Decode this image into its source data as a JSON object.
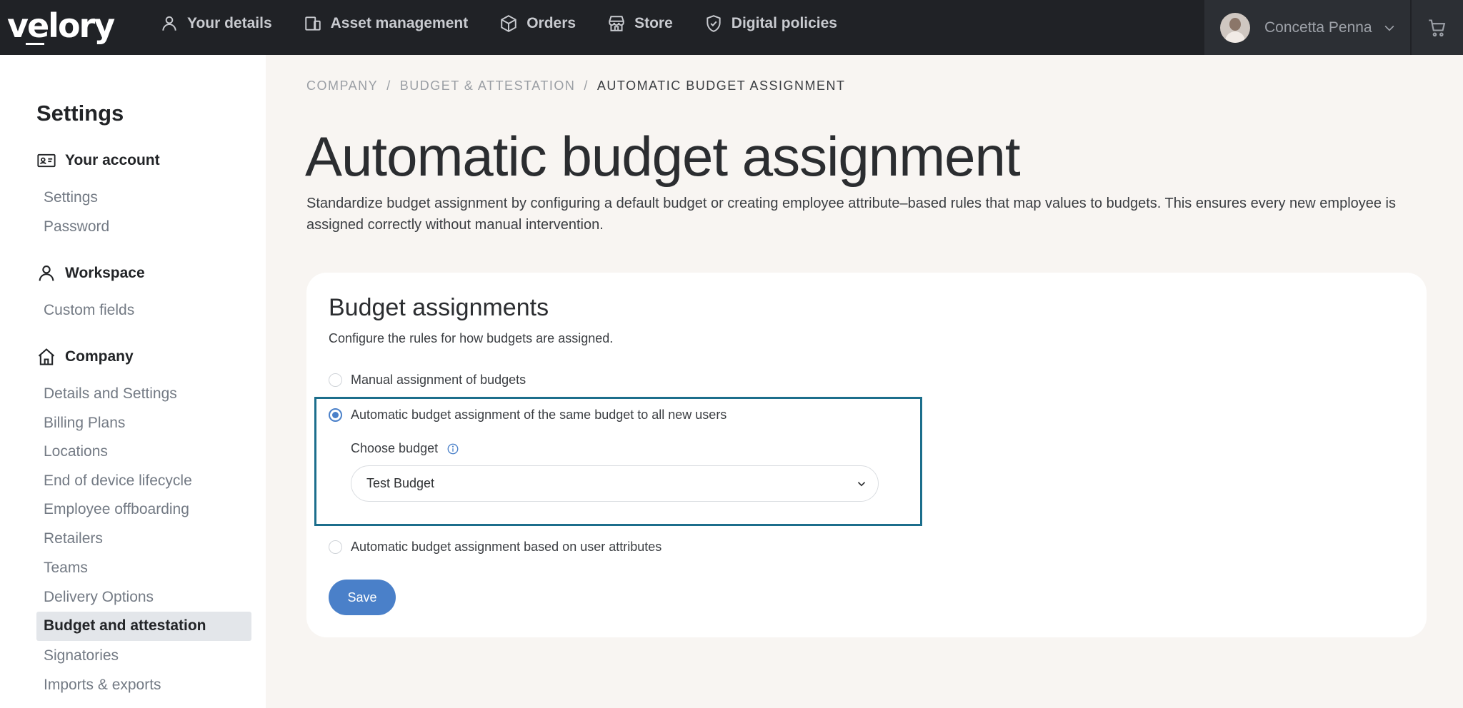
{
  "brand": {
    "logo": "velory"
  },
  "nav": {
    "items": [
      {
        "label": "Your details",
        "icon": "user-icon"
      },
      {
        "label": "Asset management",
        "icon": "devices-icon"
      },
      {
        "label": "Orders",
        "icon": "box-icon"
      },
      {
        "label": "Store",
        "icon": "store-icon"
      },
      {
        "label": "Digital policies",
        "icon": "shield-check-icon"
      }
    ],
    "user_name": "Concetta Penna",
    "cart_icon": "cart-icon"
  },
  "sidebar": {
    "title": "Settings",
    "sections": [
      {
        "label": "Your account",
        "icon": "id-card-icon",
        "links": [
          "Settings",
          "Password"
        ]
      },
      {
        "label": "Workspace",
        "icon": "user-icon",
        "links": [
          "Custom fields"
        ]
      },
      {
        "label": "Company",
        "icon": "home-icon",
        "links": [
          "Details and Settings",
          "Billing Plans",
          "Locations",
          "End of device lifecycle",
          "Employee offboarding",
          "Retailers",
          "Teams",
          "Delivery Options",
          "Budget and attestation",
          "Signatories",
          "Imports & exports"
        ]
      }
    ],
    "active_link": "Budget and attestation"
  },
  "breadcrumb": [
    "COMPANY",
    "BUDGET & ATTESTATION",
    "AUTOMATIC BUDGET ASSIGNMENT"
  ],
  "page": {
    "title": "Automatic budget assignment",
    "description": "Standardize budget assignment by configuring a default budget or creating employee attribute–based rules that map values to budgets. This ensures every new employee is assigned correctly without manual intervention."
  },
  "card": {
    "title": "Budget assignments",
    "subtitle": "Configure the rules for how budgets are assigned.",
    "options": [
      {
        "label": "Manual assignment of budgets",
        "checked": false
      },
      {
        "label": "Automatic budget assignment of the same budget to all new users",
        "checked": true
      },
      {
        "label": "Automatic budget assignment based on user attributes",
        "checked": false
      }
    ],
    "choose_budget_label": "Choose budget",
    "selected_budget": "Test Budget",
    "save_label": "Save"
  },
  "colors": {
    "topbar": "#202226",
    "accent": "#4a80c9",
    "highlight_border": "#1c6e8c",
    "page_background": "#f8f5f2"
  }
}
